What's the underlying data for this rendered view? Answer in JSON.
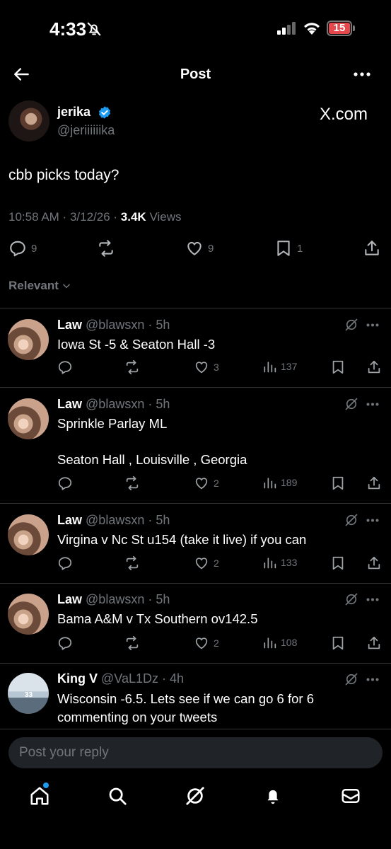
{
  "status_bar": {
    "time": "4:33",
    "battery": "15"
  },
  "header": {
    "title": "Post"
  },
  "post": {
    "name": "jerika",
    "handle": "@jeriiiiiika",
    "brand": "X.com",
    "text": "cbb picks today?",
    "time": "10:58 AM",
    "date": "3/12/26",
    "views_count": "3.4K",
    "views_label": "Views",
    "replies": "9",
    "likes": "9",
    "bookmarks": "1"
  },
  "sort": {
    "label": "Relevant"
  },
  "replies": [
    {
      "name": "Law",
      "handle": "@blawsxn",
      "age": "5h",
      "text": "Iowa St -5 & Seaton Hall -3",
      "likes": "3",
      "views": "137"
    },
    {
      "name": "Law",
      "handle": "@blawsxn",
      "age": "5h",
      "text_line1": "Sprinkle Parlay ML",
      "text_line2": "Seaton Hall , Louisville , Georgia",
      "likes": "2",
      "views": "189"
    },
    {
      "name": "Law",
      "handle": "@blawsxn",
      "age": "5h",
      "text": "Virgina v Nc St u154 (take it live) if you can",
      "likes": "2",
      "views": "133"
    },
    {
      "name": "Law",
      "handle": "@blawsxn",
      "age": "5h",
      "text": "Bama A&M v Tx Southern ov142.5",
      "likes": "2",
      "views": "108"
    },
    {
      "name": "King V",
      "handle": "@VaL1Dz",
      "age": "4h",
      "text_line1": "Wisconsin -6.5. Lets see if we can go 6 for 6",
      "text_line2": "commenting on your tweets"
    }
  ],
  "composer": {
    "placeholder": "Post your reply"
  },
  "tab_bar": [
    "home-icon",
    "search-icon",
    "grok-icon",
    "notifications-icon",
    "messages-icon"
  ],
  "colors": {
    "background": "#000000",
    "accent": "#1d9bf0",
    "muted": "#71767b",
    "battery_low": "#e5484d"
  }
}
